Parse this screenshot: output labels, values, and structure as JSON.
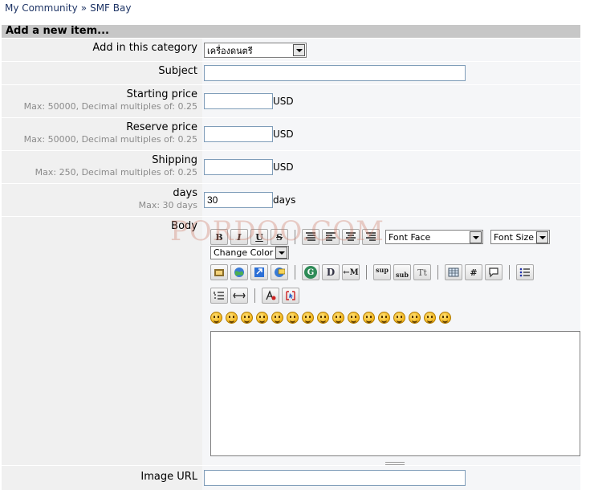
{
  "breadcrumb": {
    "home": "My Community",
    "separator": "»",
    "current": "SMF Bay"
  },
  "section_title": "Add a new item...",
  "fields": {
    "category": {
      "label": "Add in this category",
      "value": "เครื่องดนตรี"
    },
    "subject": {
      "label": "Subject",
      "value": ""
    },
    "starting_price": {
      "label": "Starting price",
      "hint": "Max: 50000, Decimal multiples of: 0.25",
      "value": "",
      "unit": "USD"
    },
    "reserve_price": {
      "label": "Reserve price",
      "hint": "Max: 50000, Decimal multiples of: 0.25",
      "value": "",
      "unit": "USD"
    },
    "shipping": {
      "label": "Shipping",
      "hint": "Max: 250, Decimal multiples of: 0.25",
      "value": "",
      "unit": "USD"
    },
    "days": {
      "label": "days",
      "hint": "Max: 30 days",
      "value": "30",
      "unit": "days"
    },
    "body": {
      "label": "Body",
      "value": ""
    },
    "image_url": {
      "label": "Image URL",
      "value": ""
    }
  },
  "toolbar": {
    "bold": "B",
    "italic": "I",
    "underline": "U",
    "strike": "S",
    "font_face": "Font Face",
    "font_size": "Font Size",
    "change_color": "Change Color",
    "glow": "G",
    "shadow": "D",
    "move": "←M",
    "sup": "sup",
    "sub": "sub",
    "tt": "Tt",
    "code": "#"
  },
  "watermark": "PORDOO.COM",
  "colors": {
    "label_bg": "#f0f0f0",
    "field_bg": "#f5f6f8",
    "title_bar": "#c7c7c7",
    "link": "#1f3566"
  }
}
